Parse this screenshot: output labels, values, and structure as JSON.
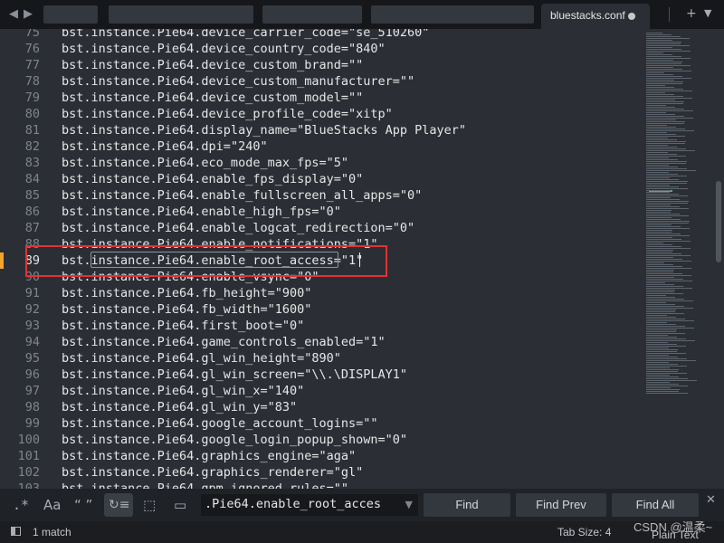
{
  "tabbar": {
    "active_tab": "bluestacks.conf",
    "new_tab_icon": "plus-icon",
    "tab_menu_icon": "chevron-down-icon"
  },
  "editor": {
    "lines": [
      {
        "no": "75",
        "key": "bst.instance.Pie64.device_carrier_code=",
        "val": "\"se_510260\""
      },
      {
        "no": "76",
        "key": "bst.instance.Pie64.device_country_code=",
        "val": "\"840\""
      },
      {
        "no": "77",
        "key": "bst.instance.Pie64.device_custom_brand=",
        "val": "\"\""
      },
      {
        "no": "78",
        "key": "bst.instance.Pie64.device_custom_manufacturer=",
        "val": "\"\""
      },
      {
        "no": "79",
        "key": "bst.instance.Pie64.device_custom_model=",
        "val": "\"\""
      },
      {
        "no": "80",
        "key": "bst.instance.Pie64.device_profile_code=",
        "val": "\"xitp\""
      },
      {
        "no": "81",
        "key": "bst.instance.Pie64.display_name=",
        "val": "\"BlueStacks App Player\""
      },
      {
        "no": "82",
        "key": "bst.instance.Pie64.dpi=",
        "val": "\"240\""
      },
      {
        "no": "83",
        "key": "bst.instance.Pie64.eco_mode_max_fps=",
        "val": "\"5\""
      },
      {
        "no": "84",
        "key": "bst.instance.Pie64.enable_fps_display=",
        "val": "\"0\""
      },
      {
        "no": "85",
        "key": "bst.instance.Pie64.enable_fullscreen_all_apps=",
        "val": "\"0\""
      },
      {
        "no": "86",
        "key": "bst.instance.Pie64.enable_high_fps=",
        "val": "\"0\""
      },
      {
        "no": "87",
        "key": "bst.instance.Pie64.enable_logcat_redirection=",
        "val": "\"0\""
      },
      {
        "no": "88",
        "key": "bst.instance.Pie64.enable_notifications=",
        "val": "\"1\""
      },
      {
        "no": "89",
        "key": "bst.instance.Pie64.enable_root_access=",
        "val": "\"1\""
      },
      {
        "no": "90",
        "key": "bst.instance.Pie64.enable_vsync=",
        "val": "\"0\""
      },
      {
        "no": "91",
        "key": "bst.instance.Pie64.fb_height=",
        "val": "\"900\""
      },
      {
        "no": "92",
        "key": "bst.instance.Pie64.fb_width=",
        "val": "\"1600\""
      },
      {
        "no": "93",
        "key": "bst.instance.Pie64.first_boot=",
        "val": "\"0\""
      },
      {
        "no": "94",
        "key": "bst.instance.Pie64.game_controls_enabled=",
        "val": "\"1\""
      },
      {
        "no": "95",
        "key": "bst.instance.Pie64.gl_win_height=",
        "val": "\"890\""
      },
      {
        "no": "96",
        "key": "bst.instance.Pie64.gl_win_screen=",
        "val": "\"\\\\.\\DISPLAY1\""
      },
      {
        "no": "97",
        "key": "bst.instance.Pie64.gl_win_x=",
        "val": "\"140\""
      },
      {
        "no": "98",
        "key": "bst.instance.Pie64.gl_win_y=",
        "val": "\"83\""
      },
      {
        "no": "99",
        "key": "bst.instance.Pie64.google_account_logins=",
        "val": "\"\""
      },
      {
        "no": "100",
        "key": "bst.instance.Pie64.google_login_popup_shown=",
        "val": "\"0\""
      },
      {
        "no": "101",
        "key": "bst.instance.Pie64.graphics_engine=",
        "val": "\"aga\""
      },
      {
        "no": "102",
        "key": "bst.instance.Pie64.graphics_renderer=",
        "val": "\"gl\""
      },
      {
        "no": "103",
        "key": "bst.instance.Pie64.gpm_ignored_rules=",
        "val": "\"\""
      }
    ],
    "current_line": "89"
  },
  "findbar": {
    "regex_label": ".*",
    "case_label": "Aa",
    "whole_word_label": "“ ”",
    "wrap_label": "↻≡",
    "in_selection_label": "⬚",
    "highlight_label": "▭",
    "query": ".Pie64.enable_root_acces",
    "find_label": "Find",
    "find_prev_label": "Find Prev",
    "find_all_label": "Find All",
    "close_label": "✕"
  },
  "statusbar": {
    "match_text": "1 match",
    "tab_size": "Tab Size: 4",
    "syntax": "Plain Text"
  },
  "watermark": "CSDN @温柔~",
  "colors": {
    "accent_marker": "#f2a52a",
    "annotation_box": "#e23232",
    "minimap_highlight": "#3fb0a8"
  }
}
